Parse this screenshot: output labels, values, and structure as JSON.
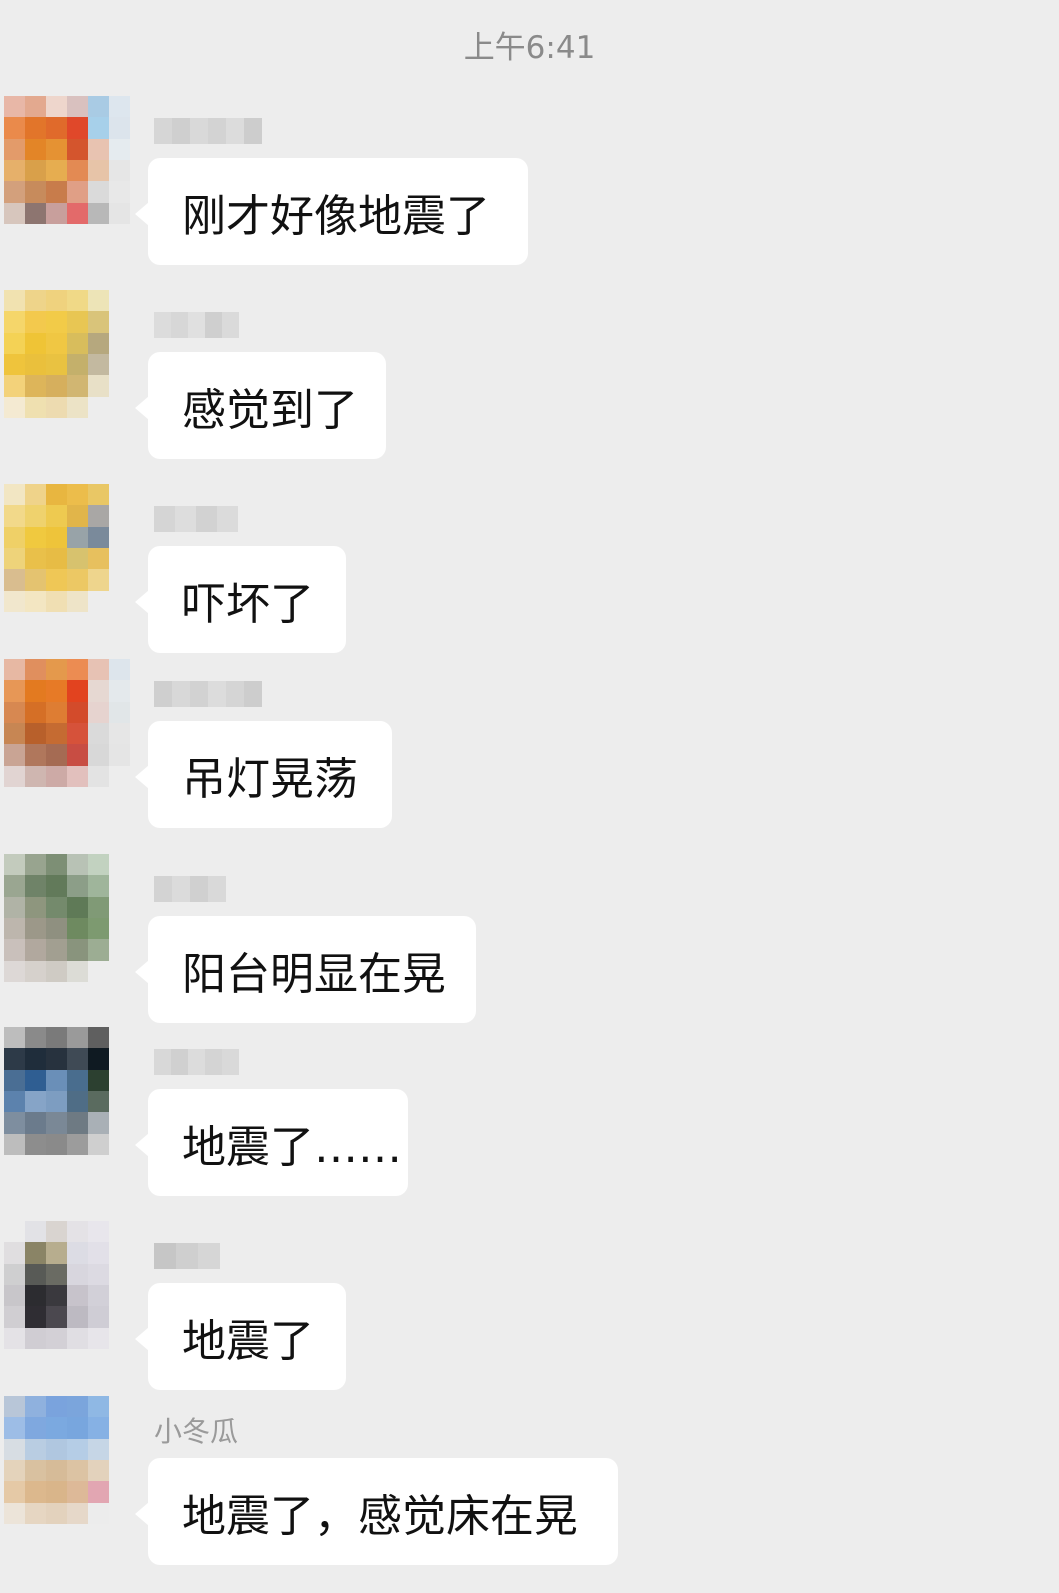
{
  "chat": {
    "timestamp": "上午6:41",
    "messages": [
      {
        "sender": "",
        "text": "刚才好像地震了",
        "avatar_colors": [
          "#e8b7a7",
          "#e3a98f",
          "#eed6cc",
          "#d9c1bf",
          "#a9cbe4",
          "#dde6ee",
          "#ea8a4b",
          "#e2752a",
          "#e06a2b",
          "#e0482a",
          "#a7d0ea",
          "#dce4ec",
          "#e39b6a",
          "#e38527",
          "#e59233",
          "#d4552d",
          "#e8c3b1",
          "#e5ebef",
          "#e6b06a",
          "#d9a04a",
          "#e6ad50",
          "#e38a53",
          "#e7c4a8",
          "#e6e6e6",
          "#d3a07c",
          "#c78b5c",
          "#c87c4b",
          "#e09f86",
          "#dadada",
          "#e8e8e8",
          "#d7c6bd",
          "#8d7570",
          "#c89f9c",
          "#e36a6a",
          "#b8b8b8",
          "#e5e5e5"
        ],
        "name_shades": [
          "#d6d6d6",
          "#cfcfcf",
          "#d9d9d9",
          "#d3d3d3",
          "#dcdcdc",
          "#cdcdcd"
        ]
      },
      {
        "sender": "",
        "text": "感觉到了",
        "avatar_colors": [
          "#f1e2b0",
          "#eed48a",
          "#efd27e",
          "#f0d987",
          "#ede4b7",
          "#ededed",
          "#f5d66a",
          "#f3c94d",
          "#f2cb48",
          "#e8c653",
          "#d9c47a",
          "#ededed",
          "#f4d255",
          "#efc436",
          "#f0c743",
          "#d8bd5c",
          "#b6a87e",
          "#ededed",
          "#efc43c",
          "#eac03c",
          "#e9c241",
          "#c4b06b",
          "#c3b9a0",
          "#ededed",
          "#f3d27a",
          "#ddb55a",
          "#d6af5d",
          "#d1b672",
          "#e8e0c7",
          "#ededed",
          "#f4ead2",
          "#efe0b0",
          "#eddbb0",
          "#ece3c6",
          "#ededed",
          "#ededed"
        ],
        "name_shades": [
          "#dcdcdc",
          "#d7d7d7",
          "#e0e0e0",
          "#cfcfcf",
          "#dadada"
        ]
      },
      {
        "sender": "",
        "text": "吓坏了",
        "avatar_colors": [
          "#f2e6c3",
          "#efd38a",
          "#e8b640",
          "#ecbd4b",
          "#e9c765",
          "#ededed",
          "#f2d98a",
          "#efd26d",
          "#eeca50",
          "#e1b54a",
          "#a9a7a5",
          "#ededed",
          "#efd067",
          "#f0c93f",
          "#eec43a",
          "#98a3a8",
          "#7a8a9b",
          "#ededed",
          "#eed37a",
          "#e9c04a",
          "#e7bc45",
          "#d7c26e",
          "#e7c05e",
          "#ededed",
          "#d9bd8f",
          "#e4c370",
          "#efc756",
          "#ecc864",
          "#eed58d",
          "#ededed",
          "#f1e7cd",
          "#f3e6c2",
          "#f0dfb3",
          "#eee4c8",
          "#ededed",
          "#ededed"
        ],
        "name_shades": [
          "#d5d5d5",
          "#dddddd",
          "#d2d2d2",
          "#dbdbdb"
        ]
      },
      {
        "sender": "",
        "text": "吊灯晃荡",
        "avatar_colors": [
          "#e7b8a3",
          "#e08f5e",
          "#e4994c",
          "#ec8c52",
          "#e7c2b4",
          "#dde5ec",
          "#e79756",
          "#e37a20",
          "#e77a26",
          "#e2431f",
          "#e6d8d2",
          "#e4e9ec",
          "#d78851",
          "#d56f26",
          "#de7d33",
          "#d34b2b",
          "#e6d3cf",
          "#e1e6e8",
          "#c78653",
          "#b8602b",
          "#c56b32",
          "#d6523a",
          "#dadada",
          "#e6e6e6",
          "#c9a494",
          "#b0775c",
          "#a56b53",
          "#c84d43",
          "#d8d8d8",
          "#e5e5e5",
          "#e1d4d2",
          "#cfb6b0",
          "#cdaaa6",
          "#e2c0bd",
          "#e3e3e3",
          "#ededed"
        ],
        "name_shades": [
          "#cfcfcf",
          "#d8d8d8",
          "#d2d2d2",
          "#dcdcdc",
          "#d5d5d5",
          "#cdcdcd"
        ]
      },
      {
        "sender": "",
        "text": "阳台明显在晃",
        "avatar_colors": [
          "#c3cbbd",
          "#98a48f",
          "#7d8f75",
          "#b8c2b5",
          "#c2d2c0",
          "#ededed",
          "#9aa691",
          "#6f8368",
          "#627a5a",
          "#8c9e88",
          "#9fb59b",
          "#ededed",
          "#b0b3a6",
          "#8e967e",
          "#748a6c",
          "#5f7a57",
          "#809a76",
          "#ededed",
          "#bdb6ad",
          "#9c9889",
          "#8f9080",
          "#6e8a60",
          "#7d9a70",
          "#ededed",
          "#c9c0bb",
          "#b1a89e",
          "#a29f91",
          "#89947d",
          "#9cad93",
          "#ededed",
          "#ddd8d6",
          "#d6d1cc",
          "#cfcbc4",
          "#dcdcd6",
          "#ededed",
          "#ededed"
        ],
        "name_shades": [
          "#d3d3d3",
          "#dbdbdb",
          "#d0d0d0",
          "#d9d9d9"
        ]
      },
      {
        "sender": "",
        "text": "地震了……",
        "avatar_colors": [
          "#bdbdbd",
          "#8a8a8a",
          "#7a7a7a",
          "#9a9a9a",
          "#5f5f5f",
          "#ededed",
          "#2d3a48",
          "#1f2d3b",
          "#27323e",
          "#3f4a55",
          "#0f1a22",
          "#ededed",
          "#4a6e94",
          "#2f5e92",
          "#6a8fb8",
          "#496d8e",
          "#2c4030",
          "#ededed",
          "#5c82ad",
          "#86a4c7",
          "#7d9dc1",
          "#4f6d86",
          "#5a6b5f",
          "#ededed",
          "#7e8e9f",
          "#6b7b8c",
          "#7a8896",
          "#6e7a83",
          "#a9b0b6",
          "#ededed",
          "#bdbdbd",
          "#8d8d8d",
          "#8a8a8a",
          "#9c9c9c",
          "#cfcfcf",
          "#ededed"
        ],
        "name_shades": [
          "#d8d8d8",
          "#d0d0d0",
          "#dcdcdc",
          "#d4d4d4",
          "#d9d9d9"
        ]
      },
      {
        "sender": "",
        "text": "地震了",
        "avatar_colors": [
          "#ededed",
          "#e2e2e6",
          "#d9d4d0",
          "#e4e2e6",
          "#e8e6ec",
          "#ededed",
          "#e0dee0",
          "#8a8466",
          "#b7ad8e",
          "#dcdce4",
          "#e2e0e8",
          "#ededed",
          "#cfcfd0",
          "#585a56",
          "#6a6b63",
          "#d8d6de",
          "#dcdae2",
          "#ededed",
          "#c8c6ca",
          "#2c2c30",
          "#3a393e",
          "#c7c3cb",
          "#d2d0d8",
          "#ededed",
          "#d0ced2",
          "#2f2d33",
          "#4b484f",
          "#bdbac2",
          "#cfcdd5",
          "#ededed",
          "#e4e2e6",
          "#d0cdd3",
          "#d3d0d6",
          "#e0dee3",
          "#e7e5ea",
          "#ededed"
        ],
        "name_shades": [
          "#c6c6c6",
          "#cfcfcf",
          "#d6d6d6"
        ]
      },
      {
        "sender": "小冬瓜",
        "text": "地震了，感觉床在晃",
        "avatar_colors": [
          "#b8c6d8",
          "#8fb1de",
          "#7aa3dd",
          "#7ba5dc",
          "#8fb8e4",
          "#ededed",
          "#9dbde6",
          "#7fa8df",
          "#7ba9e0",
          "#78a6de",
          "#86b1e4",
          "#ededed",
          "#d7dde3",
          "#b9cde2",
          "#b0c7e0",
          "#b5cde6",
          "#c6d6e6",
          "#ededed",
          "#e4d3bb",
          "#d9c1a0",
          "#d6bb98",
          "#dcc3a3",
          "#e3d2bc",
          "#ededed",
          "#e5c9a6",
          "#dcb88d",
          "#d9b58a",
          "#ddb998",
          "#e2a6b2",
          "#ededed",
          "#ece4d9",
          "#e6d6c2",
          "#e3d2bd",
          "#e6d8c9",
          "#ececec",
          "#ededed"
        ],
        "name_shades": []
      }
    ]
  }
}
